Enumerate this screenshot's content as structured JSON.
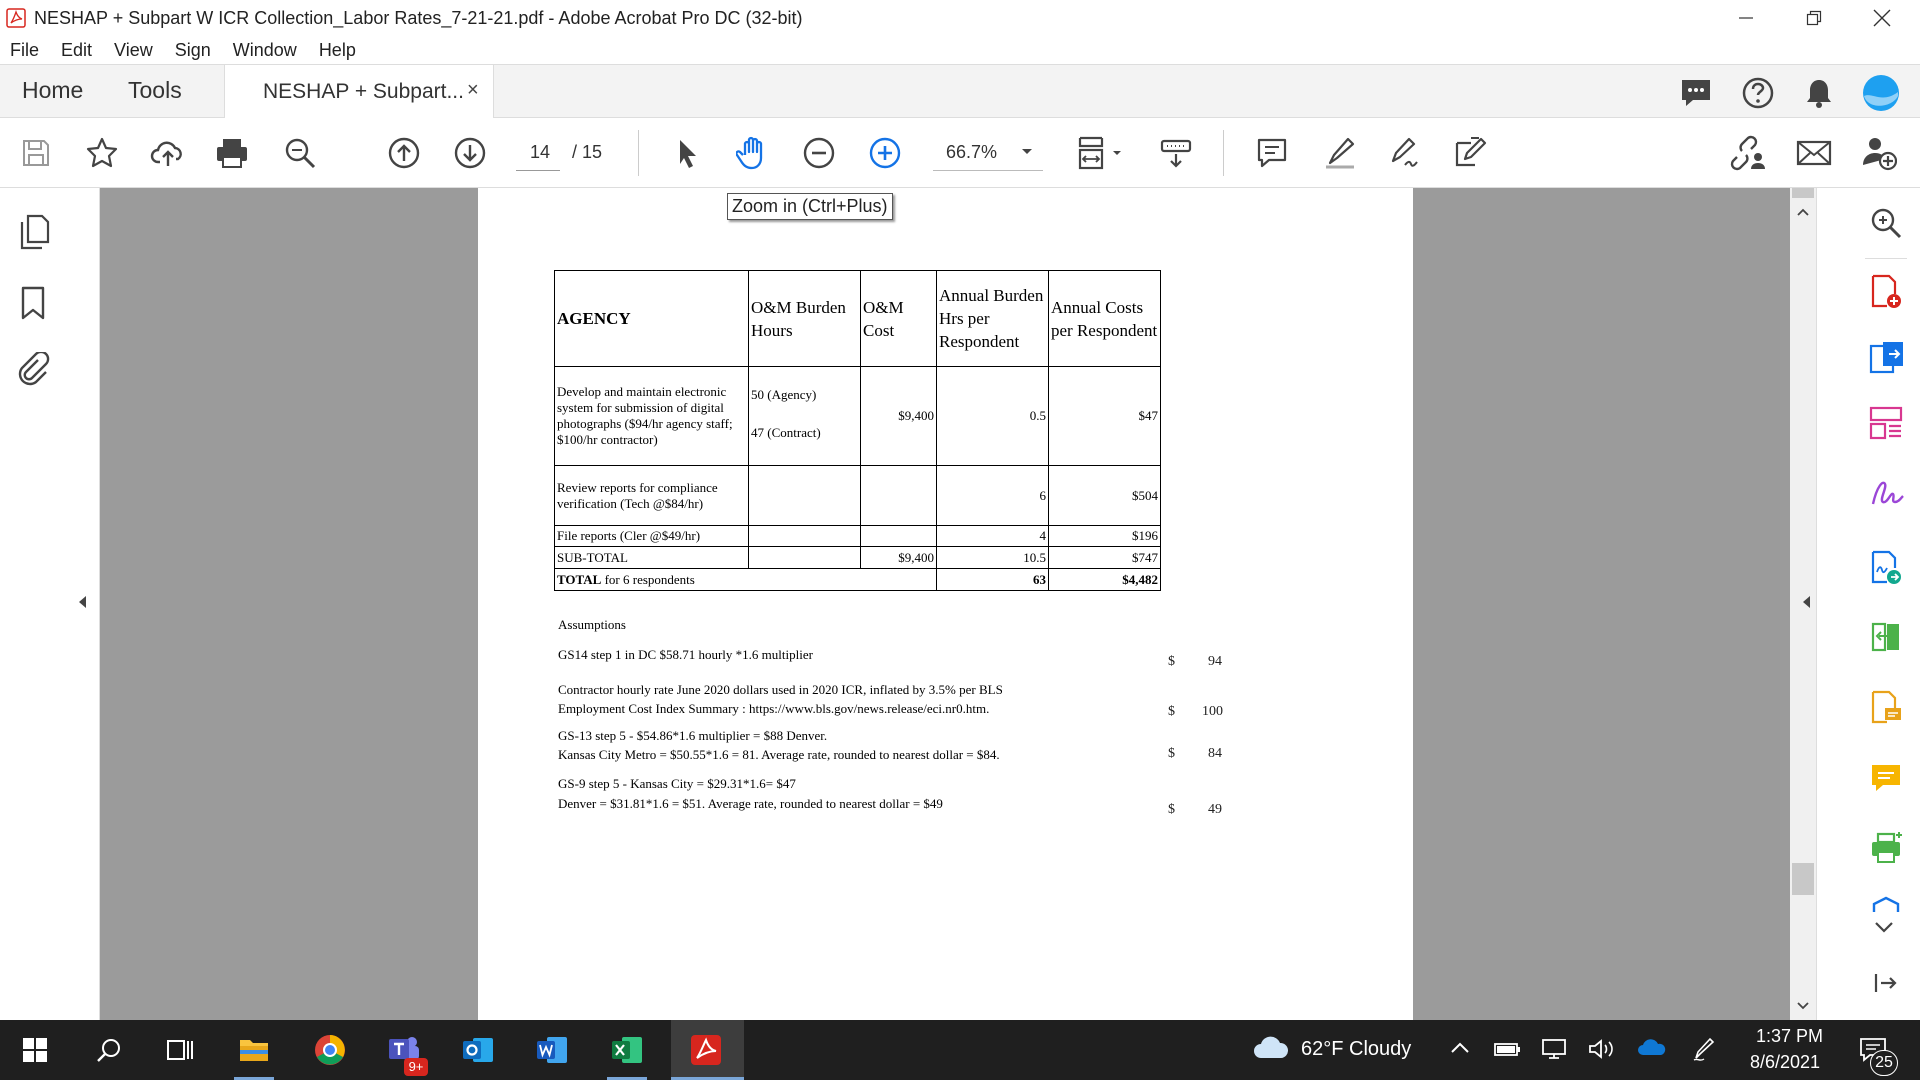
{
  "window": {
    "title": "NESHAP + Subpart W ICR Collection_Labor Rates_7-21-21.pdf - Adobe Acrobat Pro DC (32-bit)",
    "minimize_icon": "minimize-icon",
    "restore_icon": "restore-icon",
    "close_icon": "close-icon"
  },
  "menu": [
    "File",
    "Edit",
    "View",
    "Sign",
    "Window",
    "Help"
  ],
  "tabs": {
    "home": "Home",
    "tools": "Tools",
    "document": "NESHAP + Subpart...",
    "close": "×"
  },
  "toolbar": {
    "page_current": "14",
    "page_total": "/ 15",
    "zoom": "66.7%",
    "tooltip": "Zoom in (Ctrl+Plus)"
  },
  "table": {
    "headers": [
      "AGENCY",
      "O&M Burden Hours",
      "O&M Cost",
      "Annual Burden Hrs per Respondent",
      "Annual Costs per Respondent"
    ],
    "rows": [
      {
        "agency": "Develop and maintain electronic system for submission of digital photographs ($94/hr agency staff; $100/hr contractor)",
        "hours_1": "50 (Agency)",
        "hours_2": "47 (Contract)",
        "cost": "$9,400",
        "burden": "0.5",
        "annual": "$47"
      },
      {
        "agency": "Review reports for compliance verification (Tech @$84/hr)",
        "hours_1": "",
        "hours_2": "",
        "cost": "",
        "burden": "6",
        "annual": "$504"
      },
      {
        "agency": "File reports (Cler @$49/hr)",
        "hours_1": "",
        "hours_2": "",
        "cost": "",
        "burden": "4",
        "annual": "$196"
      },
      {
        "agency": "SUB-TOTAL",
        "hours_1": "",
        "hours_2": "",
        "cost": "$9,400",
        "burden": "10.5",
        "annual": "$747"
      }
    ],
    "total": {
      "label_bold": "TOTAL",
      "label_rest": "for 6 respondents",
      "burden": "63",
      "annual": "$4,482"
    }
  },
  "assumptions": {
    "heading": "Assumptions",
    "items": [
      {
        "lines": [
          "GS14 step 1 in DC $58.71 hourly *1.6 multiplier"
        ],
        "currency": "$",
        "value": "94"
      },
      {
        "lines": [
          "Contractor hourly rate June 2020 dollars used in 2020 ICR, inflated by 3.5%  per BLS",
          "Employment Cost Index Summary : https://www.bls.gov/news.release/eci.nr0.htm."
        ],
        "currency": "$",
        "value": "100"
      },
      {
        "lines": [
          "GS-13 step 5 - $54.86*1.6 multiplier = $88 Denver.",
          "Kansas City Metro = $50.55*1.6 = 81. Average rate, rounded to nearest dollar = $84."
        ],
        "currency": "$",
        "value": "84"
      },
      {
        "lines": [
          "GS-9 step 5 - Kansas City = $29.31*1.6= $47",
          "Denver = $31.81*1.6 = $51. Average rate, rounded to nearest dollar = $49"
        ],
        "currency": "$",
        "value": "49"
      }
    ]
  },
  "taskbar": {
    "teams_badge": "9+",
    "weather": "62°F  Cloudy",
    "time": "1:37 PM",
    "date": "8/6/2021",
    "notifications": "25"
  },
  "colors": {
    "acrobat_red": "#d7261e",
    "accent_blue": "#1473e6",
    "taskbar": "#1f1f1f",
    "canvas_gray": "#9b9b9b"
  }
}
